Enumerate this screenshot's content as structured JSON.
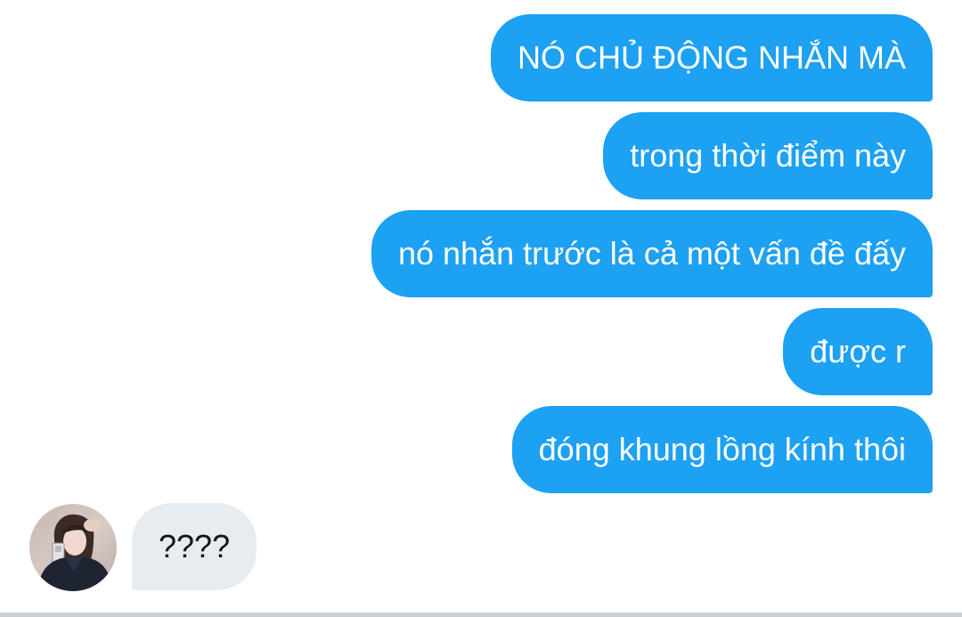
{
  "conversation": {
    "outgoing": [
      {
        "text": "NÓ CHỦ ĐỘNG NHẮN MÀ"
      },
      {
        "text": "trong thời điểm này"
      },
      {
        "text": "nó nhắn trước là cả một vấn đề đấy"
      },
      {
        "text": "được r"
      },
      {
        "text": "đóng khung lồng kính thôi"
      }
    ],
    "incoming": [
      {
        "text": "????",
        "avatar_icon": "user-avatar"
      }
    ]
  },
  "colors": {
    "outgoing_bubble": "#1DA1F2",
    "incoming_bubble": "#E6ECF0",
    "outgoing_text": "#FFFFFF",
    "incoming_text": "#14171A"
  }
}
